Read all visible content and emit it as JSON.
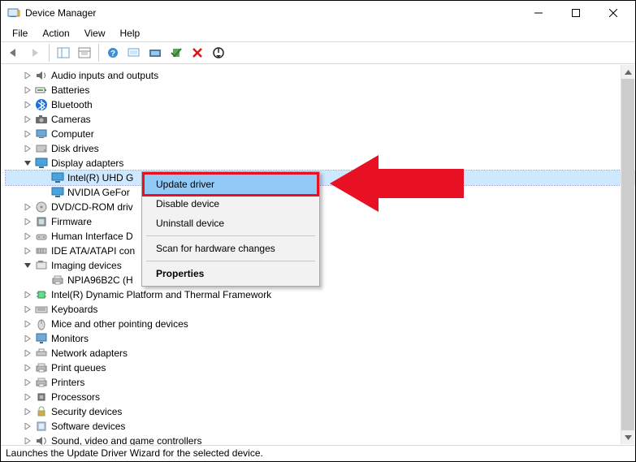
{
  "window": {
    "title": "Device Manager"
  },
  "menubar": [
    "File",
    "Action",
    "View",
    "Help"
  ],
  "tree": {
    "items": [
      {
        "label": "Audio inputs and outputs",
        "indent": 1,
        "expander": "right",
        "icon": "speaker"
      },
      {
        "label": "Batteries",
        "indent": 1,
        "expander": "right",
        "icon": "battery"
      },
      {
        "label": "Bluetooth",
        "indent": 1,
        "expander": "right",
        "icon": "bluetooth"
      },
      {
        "label": "Cameras",
        "indent": 1,
        "expander": "right",
        "icon": "camera"
      },
      {
        "label": "Computer",
        "indent": 1,
        "expander": "right",
        "icon": "computer"
      },
      {
        "label": "Disk drives",
        "indent": 1,
        "expander": "right",
        "icon": "disk"
      },
      {
        "label": "Display adapters",
        "indent": 1,
        "expander": "down",
        "icon": "display"
      },
      {
        "label": "Intel(R) UHD G",
        "indent": 2,
        "expander": "none",
        "icon": "display",
        "selected": true
      },
      {
        "label": "NVIDIA GeFor",
        "indent": 2,
        "expander": "none",
        "icon": "display"
      },
      {
        "label": "DVD/CD-ROM driv",
        "indent": 1,
        "expander": "right",
        "icon": "cdrom"
      },
      {
        "label": "Firmware",
        "indent": 1,
        "expander": "right",
        "icon": "firmware"
      },
      {
        "label": "Human Interface D",
        "indent": 1,
        "expander": "right",
        "icon": "hid"
      },
      {
        "label": "IDE ATA/ATAPI con",
        "indent": 1,
        "expander": "right",
        "icon": "ide"
      },
      {
        "label": "Imaging devices",
        "indent": 1,
        "expander": "down",
        "icon": "imaging"
      },
      {
        "label": "NPIA96B2C (H",
        "indent": 2,
        "expander": "none",
        "icon": "printer"
      },
      {
        "label": "Intel(R) Dynamic Platform and Thermal Framework",
        "indent": 1,
        "expander": "right",
        "icon": "chip"
      },
      {
        "label": "Keyboards",
        "indent": 1,
        "expander": "right",
        "icon": "keyboard"
      },
      {
        "label": "Mice and other pointing devices",
        "indent": 1,
        "expander": "right",
        "icon": "mouse"
      },
      {
        "label": "Monitors",
        "indent": 1,
        "expander": "right",
        "icon": "monitor"
      },
      {
        "label": "Network adapters",
        "indent": 1,
        "expander": "right",
        "icon": "network"
      },
      {
        "label": "Print queues",
        "indent": 1,
        "expander": "right",
        "icon": "printer"
      },
      {
        "label": "Printers",
        "indent": 1,
        "expander": "right",
        "icon": "printer"
      },
      {
        "label": "Processors",
        "indent": 1,
        "expander": "right",
        "icon": "cpu"
      },
      {
        "label": "Security devices",
        "indent": 1,
        "expander": "right",
        "icon": "security"
      },
      {
        "label": "Software devices",
        "indent": 1,
        "expander": "right",
        "icon": "software"
      },
      {
        "label": "Sound, video and game controllers",
        "indent": 1,
        "expander": "right",
        "icon": "sound"
      }
    ]
  },
  "context_menu": {
    "items": [
      {
        "label": "Update driver",
        "highlighted": true
      },
      {
        "label": "Disable device"
      },
      {
        "label": "Uninstall device"
      },
      {
        "separator": true
      },
      {
        "label": "Scan for hardware changes"
      },
      {
        "separator": true
      },
      {
        "label": "Properties",
        "bold": true
      }
    ]
  },
  "statusbar": "Launches the Update Driver Wizard for the selected device."
}
